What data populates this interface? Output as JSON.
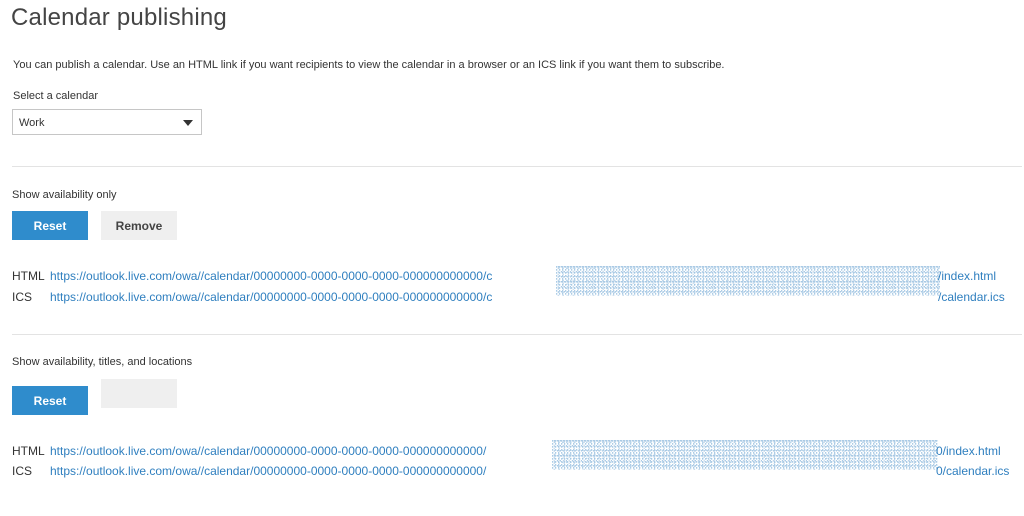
{
  "page": {
    "title": "Calendar publishing",
    "intro": "You can publish a calendar. Use an HTML link if you want recipients to view the calendar in a browser or an ICS link if you want them to subscribe.",
    "select_label": "Select a calendar",
    "selected_calendar": "Work"
  },
  "sections": [
    {
      "label": "Show availability only",
      "reset_label": "Reset",
      "remove_label": "Remove",
      "html_label": "HTML",
      "html_url": "https://outlook.live.com/owa//calendar/00000000-0000-0000-0000-000000000000/c",
      "html_tail": "/index.html",
      "ics_label": "ICS",
      "ics_url": "https://outlook.live.com/owa//calendar/00000000-0000-0000-0000-000000000000/c",
      "ics_tail": "/calendar.ics"
    },
    {
      "label": "Show availability, titles, and locations",
      "reset_label": "Reset",
      "html_label": "HTML",
      "html_url": "https://outlook.live.com/owa//calendar/00000000-0000-0000-0000-000000000000/",
      "html_tail": "0/index.html",
      "ics_label": "ICS",
      "ics_url": "https://outlook.live.com/owa//calendar/00000000-0000-0000-0000-000000000000/",
      "ics_tail": "0/calendar.ics"
    }
  ],
  "colors": {
    "primary_button": "#2f8ccc",
    "link": "#2f7fbf",
    "secondary_button": "#efefef"
  },
  "icons": {
    "select_caret": "chevron-down-icon"
  }
}
